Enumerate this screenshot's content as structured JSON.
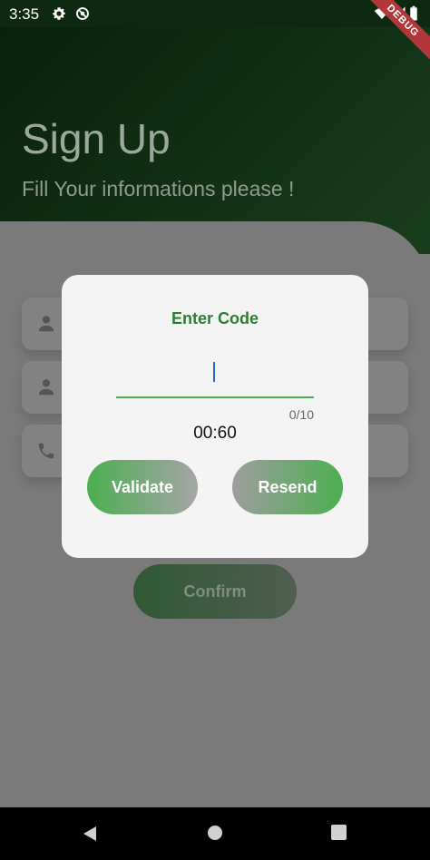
{
  "status_bar": {
    "time": "3:35",
    "icons": [
      "settings-icon",
      "do-not-disturb-icon",
      "wifi-icon",
      "signal-icon",
      "battery-icon"
    ],
    "debug_label": "DEBUG"
  },
  "header": {
    "title": "Sign Up",
    "subtitle": "Fill Your informations please !"
  },
  "form": {
    "fields": [
      {
        "icon": "person-icon"
      },
      {
        "icon": "person-icon"
      },
      {
        "icon": "phone-icon"
      }
    ],
    "confirm_label": "Confirm"
  },
  "dialog": {
    "title": "Enter Code",
    "code_value": "",
    "counter": "0/10",
    "timer": "00:60",
    "validate_label": "Validate",
    "resend_label": "Resend"
  },
  "nav": {
    "buttons": [
      "back-icon",
      "home-icon",
      "recents-icon"
    ]
  },
  "colors": {
    "accent": "#4caf50",
    "accent_dark": "#2e7d32",
    "header": "#1f5a23",
    "scrim": "#7a7a7a"
  }
}
